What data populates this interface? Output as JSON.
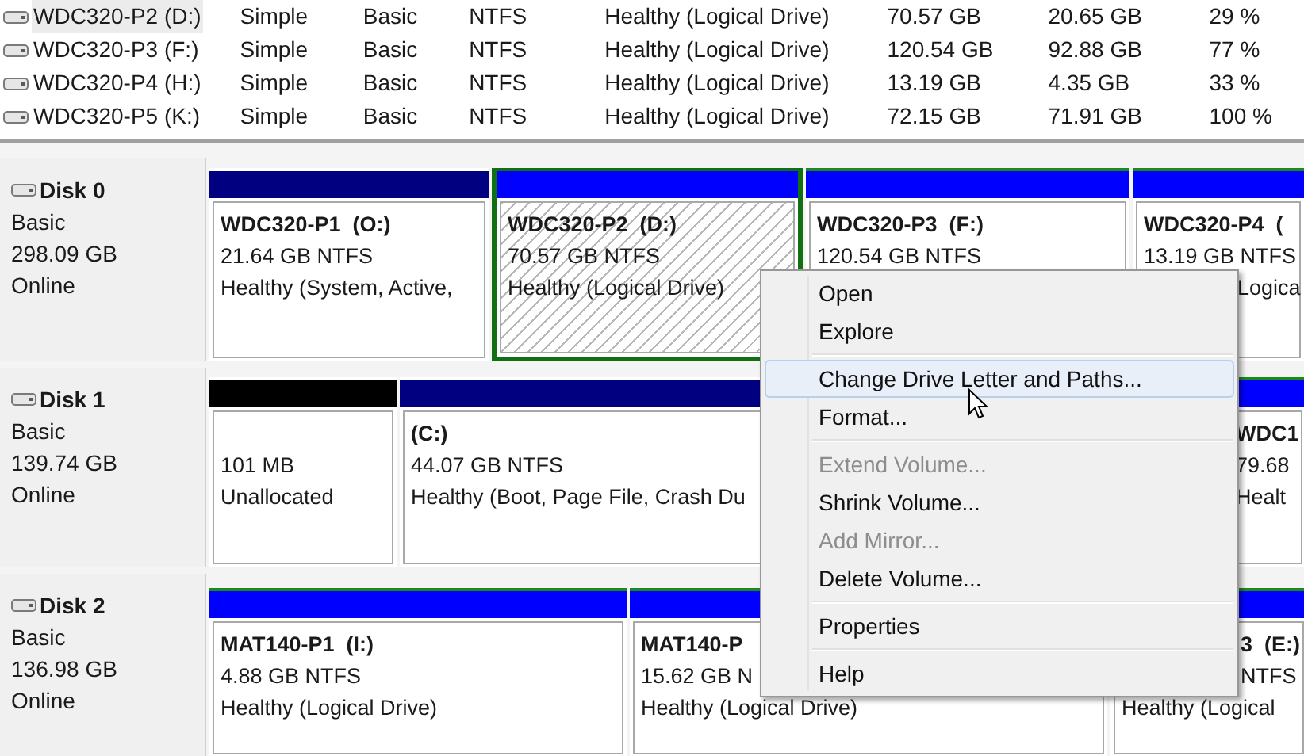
{
  "volumes": [
    {
      "name": "WDC320-P2 (D:)",
      "layout": "Simple",
      "type": "Basic",
      "file_system": "NTFS",
      "status": "Healthy (Logical Drive)",
      "capacity": "70.57 GB",
      "free_space": "20.65 GB",
      "percent_free": "29 %",
      "selected": true
    },
    {
      "name": "WDC320-P3 (F:)",
      "layout": "Simple",
      "type": "Basic",
      "file_system": "NTFS",
      "status": "Healthy (Logical Drive)",
      "capacity": "120.54 GB",
      "free_space": "92.88 GB",
      "percent_free": "77 %",
      "selected": false
    },
    {
      "name": "WDC320-P4 (H:)",
      "layout": "Simple",
      "type": "Basic",
      "file_system": "NTFS",
      "status": "Healthy (Logical Drive)",
      "capacity": "13.19 GB",
      "free_space": "4.35 GB",
      "percent_free": "33 %",
      "selected": false
    },
    {
      "name": "WDC320-P5 (K:)",
      "layout": "Simple",
      "type": "Basic",
      "file_system": "NTFS",
      "status": "Healthy (Logical Drive)",
      "capacity": "72.15 GB",
      "free_space": "71.91 GB",
      "percent_free": "100 %",
      "selected": false
    }
  ],
  "disks": [
    {
      "name": "Disk 0",
      "type": "Basic",
      "size": "298.09 GB",
      "status": "Online",
      "partitions": [
        {
          "kind": "primary",
          "title": "WDC320-P1  (O:)",
          "size": "21.64 GB NTFS",
          "status": "Healthy (System, Active,",
          "selected": false
        },
        {
          "kind": "logical",
          "title": "WDC320-P2  (D:)",
          "size": "70.57 GB NTFS",
          "status": "Healthy (Logical Drive)",
          "selected": true
        },
        {
          "kind": "logical",
          "title": "WDC320-P3  (F:)",
          "size": "120.54 GB NTFS",
          "selected": false
        },
        {
          "kind": "logical",
          "title": "WDC320-P4  (",
          "size": "13.19 GB NTFS",
          "status": "Logica",
          "selected": false
        }
      ]
    },
    {
      "name": "Disk 1",
      "type": "Basic",
      "size": "139.74 GB",
      "status": "Online",
      "partitions": [
        {
          "kind": "unallocated",
          "size": "101 MB",
          "status": "Unallocated",
          "selected": false
        },
        {
          "kind": "primary",
          "title": "(C:)",
          "size": "44.07 GB NTFS",
          "status": "Healthy (Boot, Page File, Crash Du",
          "selected": false
        },
        {
          "kind": "logical",
          "title": "WDC1",
          "size": "79.68",
          "status": "Healt",
          "selected": false
        }
      ]
    },
    {
      "name": "Disk 2",
      "type": "Basic",
      "size": "136.98 GB",
      "status": "Online",
      "partitions": [
        {
          "kind": "logical",
          "title": "MAT140-P1  (I:)",
          "size": "4.88 GB NTFS",
          "status": "Healthy (Logical Drive)",
          "selected": false
        },
        {
          "kind": "logical",
          "title": "MAT140-P",
          "size": "15.62 GB N",
          "status": "Healthy (Logical Drive)",
          "selected": false
        },
        {
          "kind": "logical",
          "title": "3  (E:)",
          "size": "NTFS",
          "status": "Healthy (Logical",
          "selected": false
        }
      ]
    }
  ],
  "context_menu": [
    {
      "kind": "item",
      "label": "Open",
      "disabled": false,
      "selected": false
    },
    {
      "kind": "item",
      "label": "Explore",
      "disabled": false,
      "selected": false
    },
    {
      "kind": "separator"
    },
    {
      "kind": "item",
      "label": "Change Drive Letter and Paths...",
      "disabled": false,
      "selected": true
    },
    {
      "kind": "item",
      "label": "Format...",
      "disabled": false,
      "selected": false
    },
    {
      "kind": "separator"
    },
    {
      "kind": "item",
      "label": "Extend Volume...",
      "disabled": true,
      "selected": false
    },
    {
      "kind": "item",
      "label": "Shrink Volume...",
      "disabled": false,
      "selected": false
    },
    {
      "kind": "item",
      "label": "Add Mirror...",
      "disabled": true,
      "selected": false
    },
    {
      "kind": "item",
      "label": "Delete Volume...",
      "disabled": false,
      "selected": false
    },
    {
      "kind": "separator"
    },
    {
      "kind": "item",
      "label": "Properties",
      "disabled": false,
      "selected": false
    },
    {
      "kind": "separator"
    },
    {
      "kind": "item",
      "label": "Help",
      "disabled": false,
      "selected": false
    }
  ]
}
